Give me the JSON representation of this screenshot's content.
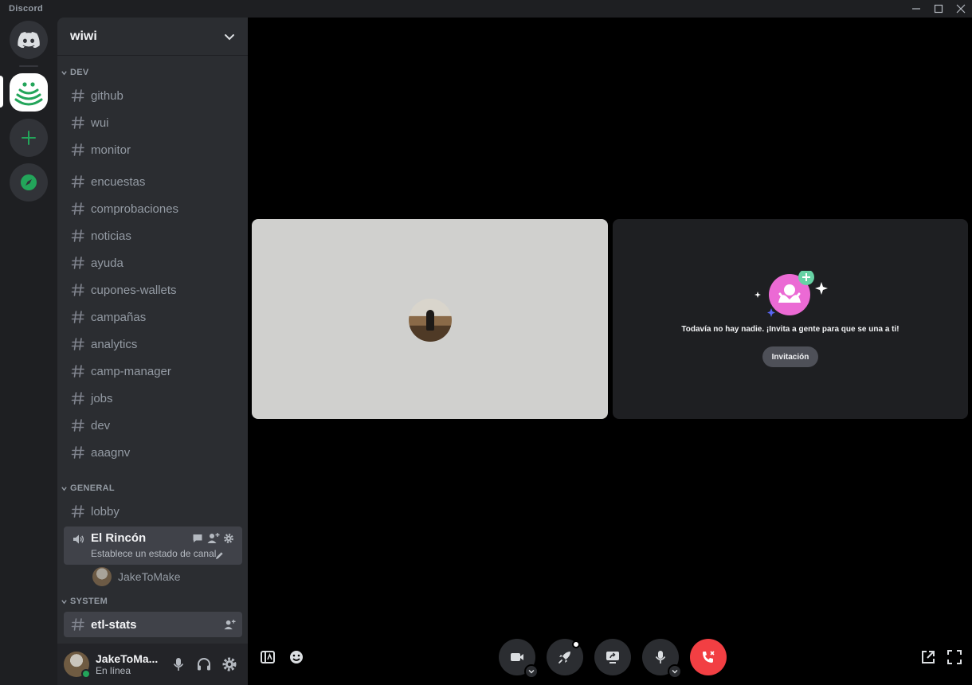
{
  "app": {
    "title": "Discord"
  },
  "guild": {
    "name": "wiwi"
  },
  "categories": {
    "dev": "DEV",
    "general": "GENERAL",
    "system": "SYSTEM"
  },
  "dev_channels": [
    "github",
    "wui",
    "monitor",
    "encuestas",
    "comprobaciones",
    "noticias",
    "ayuda",
    "cupones-wallets",
    "campañas",
    "analytics",
    "camp-manager",
    "jobs",
    "dev",
    "aaagnv"
  ],
  "general_channels": [
    "lobby"
  ],
  "voice": {
    "name": "El Rincón",
    "status": "Establece un estado de canal",
    "user": "JakeToMake"
  },
  "system_channels": [
    "etl-stats"
  ],
  "user": {
    "name": "JakeToMa...",
    "status": "En línea",
    "status_color": "#23a55a"
  },
  "invite": {
    "message": "Todavía no hay nadie. ¡Invita a gente para que se una a ti!",
    "button": "Invitación"
  },
  "colors": {
    "accent_green": "#23a55a",
    "hangup_red": "#f23f43",
    "invite_pink": "#eb6ad4"
  }
}
